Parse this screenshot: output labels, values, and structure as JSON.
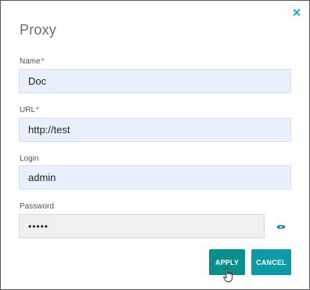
{
  "dialog": {
    "title": "Proxy",
    "close_icon": "close-icon",
    "accent_color": "#1e9fd6"
  },
  "fields": {
    "name": {
      "label": "Name",
      "required_mark": "*",
      "value": "Doc"
    },
    "url": {
      "label": "URL",
      "required_mark": "*",
      "value": "http://test"
    },
    "login": {
      "label": "Login",
      "value": "admin"
    },
    "password": {
      "label": "Password",
      "value": "•••••",
      "toggle_icon": "eye-icon"
    }
  },
  "buttons": {
    "apply_label": "APPLY",
    "cancel_label": "CANCEL",
    "apply_color": "#0a8f8c",
    "cancel_color": "#0b9aa6"
  }
}
